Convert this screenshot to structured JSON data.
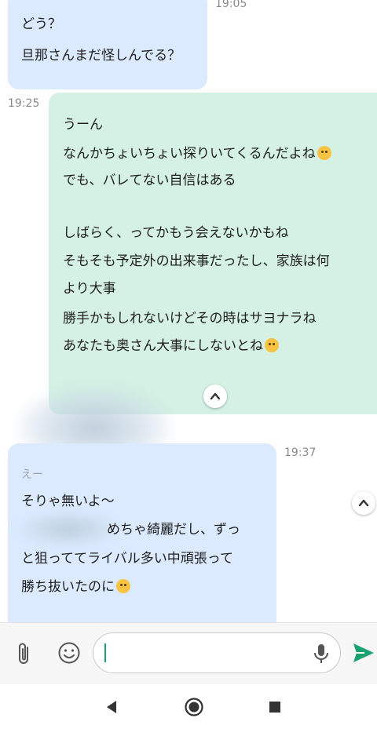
{
  "messages": [
    {
      "id": "m1",
      "time": "19:05",
      "lines": [
        "どう？",
        "旦那さんまだ怪しんでる？"
      ]
    },
    {
      "id": "m2",
      "time": "19:25",
      "lines": [
        "うーん",
        "なんかちょいちょい探りいてくるんだよね",
        "でも、バレてない自信はある",
        "",
        "しばらく、ってかもう会えないかもね",
        "そもそも予定外の出来事だったし、家族は何",
        "より大事",
        "勝手かもしれないけどその時はサヨナラね",
        "あなたも奥さん大事にしないとね"
      ]
    },
    {
      "id": "m3",
      "time": "19:37",
      "sender": "えー",
      "lines": [
        "そりゃ無いよ〜",
        "めちゃ綺麗だし、ずっ",
        "と狙っててライバル多い中頑張って",
        "勝ち抜いたのに"
      ]
    }
  ],
  "emoji": {
    "laugh": "grinning-sweat-emoji",
    "kiss": "kissing-emoji",
    "cry": "crying-emoji"
  },
  "input": {
    "value": "",
    "placeholder": ""
  },
  "colors": {
    "incoming": "#dbeafe",
    "outgoing": "#d4f1e4",
    "send": "#1aa36f"
  }
}
